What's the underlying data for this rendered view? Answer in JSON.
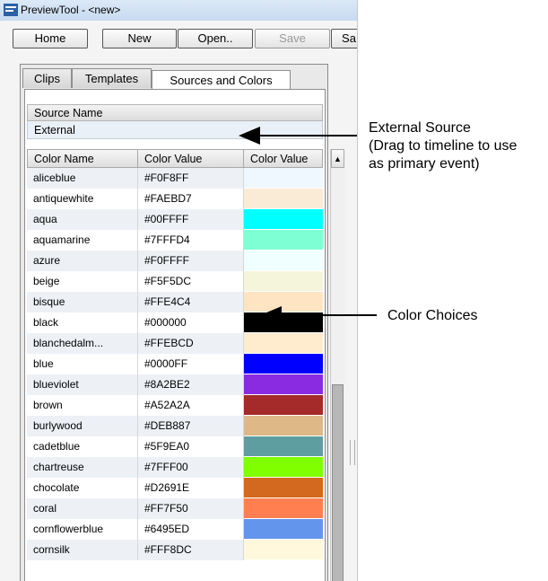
{
  "window": {
    "title": "PreviewTool - <new>"
  },
  "toolbar": {
    "buttons": [
      {
        "label": "Home",
        "enabled": true
      },
      {
        "label": "New",
        "enabled": true
      },
      {
        "label": "Open..",
        "enabled": true
      },
      {
        "label": "Save",
        "enabled": false
      },
      {
        "label": "Sa",
        "enabled": true
      }
    ]
  },
  "tabs": [
    {
      "label": "Clips",
      "active": false
    },
    {
      "label": "Templates",
      "active": false
    },
    {
      "label": "Sources and Colors",
      "active": true
    }
  ],
  "sources": {
    "header": "Source Name",
    "rows": [
      "External"
    ]
  },
  "colors": {
    "headers": [
      "Color Name",
      "Color Value",
      "Color Value"
    ],
    "rows": [
      {
        "name": "aliceblue",
        "value": "#F0F8FF",
        "swatch": "#F0F8FF"
      },
      {
        "name": "antiquewhite",
        "value": "#FAEBD7",
        "swatch": "#FAEBD7"
      },
      {
        "name": "aqua",
        "value": "#00FFFF",
        "swatch": "#00FFFF"
      },
      {
        "name": "aquamarine",
        "value": "#7FFFD4",
        "swatch": "#7FFFD4"
      },
      {
        "name": "azure",
        "value": "#F0FFFF",
        "swatch": "#F0FFFF"
      },
      {
        "name": "beige",
        "value": "#F5F5DC",
        "swatch": "#F5F5DC"
      },
      {
        "name": "bisque",
        "value": "#FFE4C4",
        "swatch": "#FFE4C4"
      },
      {
        "name": "black",
        "value": "#000000",
        "swatch": "#000000"
      },
      {
        "name": "blanchedalm...",
        "value": "#FFEBCD",
        "swatch": "#FFEBCD"
      },
      {
        "name": "blue",
        "value": "#0000FF",
        "swatch": "#0000FF"
      },
      {
        "name": "blueviolet",
        "value": "#8A2BE2",
        "swatch": "#8A2BE2"
      },
      {
        "name": "brown",
        "value": "#A52A2A",
        "swatch": "#A52A2A"
      },
      {
        "name": "burlywood",
        "value": "#DEB887",
        "swatch": "#DEB887"
      },
      {
        "name": "cadetblue",
        "value": "#5F9EA0",
        "swatch": "#5F9EA0"
      },
      {
        "name": "chartreuse",
        "value": "#7FFF00",
        "swatch": "#7FFF00"
      },
      {
        "name": "chocolate",
        "value": "#D2691E",
        "swatch": "#D2691E"
      },
      {
        "name": "coral",
        "value": "#FF7F50",
        "swatch": "#FF7F50"
      },
      {
        "name": "cornflowerblue",
        "value": "#6495ED",
        "swatch": "#6495ED"
      },
      {
        "name": "cornsilk",
        "value": "#FFF8DC",
        "swatch": "#FFF8DC"
      }
    ]
  },
  "callouts": {
    "external_source": [
      "External Source",
      "(Drag to timeline to use",
      "as primary event)"
    ],
    "color_choices": "Color Choices"
  },
  "colors_ui": {
    "title_bar": "#C7DAF0",
    "row_alt": "#EDF1F6",
    "source_row": "#EAF0F7"
  }
}
